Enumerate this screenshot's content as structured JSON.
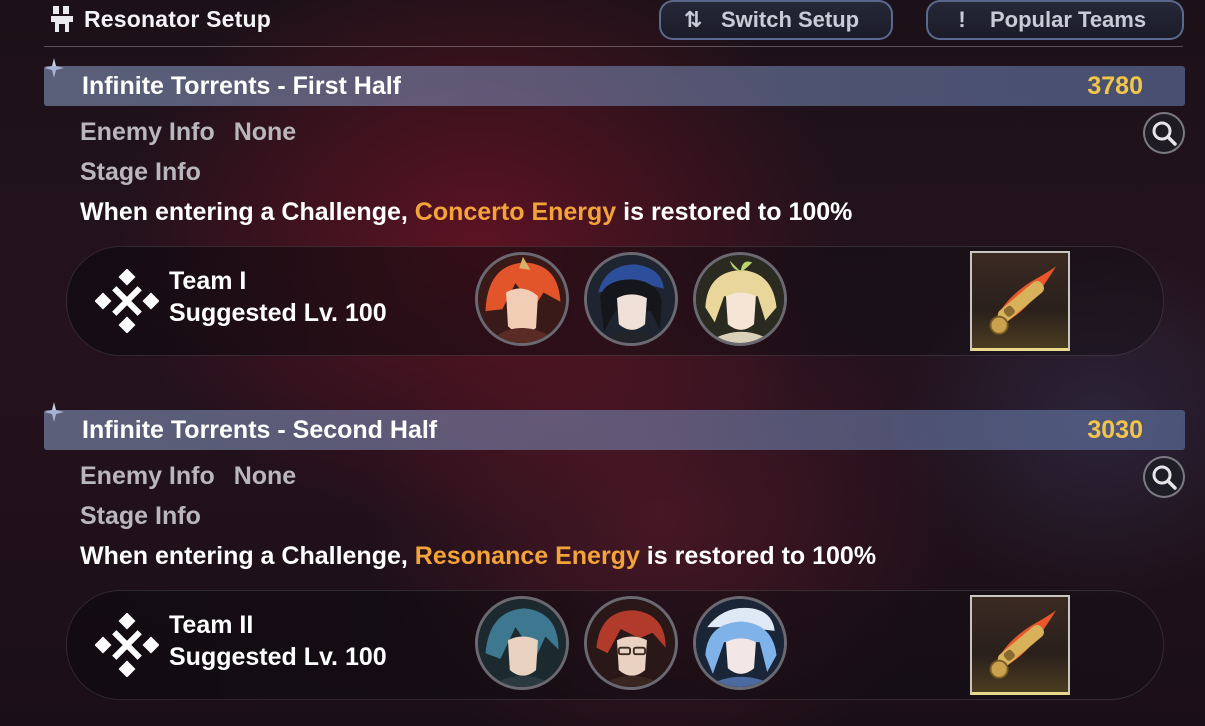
{
  "header": {
    "title": "Resonator Setup",
    "switch_setup_label": "Switch Setup",
    "popular_teams_label": "Popular Teams",
    "switch_icon": "swap-vertical-icon",
    "popular_icon": "exclamation-icon"
  },
  "challenges": [
    {
      "title": "Infinite Torrents - First Half",
      "score": "3780",
      "enemy_label": "Enemy Info",
      "enemy_value": "None",
      "stage_label": "Stage Info",
      "desc_prefix": "When entering a Challenge, ",
      "desc_highlight": "Concerto Energy",
      "desc_suffix": " is restored to 100%",
      "team_name": "Team I",
      "team_level": "Suggested Lv. 100"
    },
    {
      "title": "Infinite Torrents - Second Half",
      "score": "3030",
      "enemy_label": "Enemy Info",
      "enemy_value": "None",
      "stage_label": "Stage Info",
      "desc_prefix": "When entering a Challenge, ",
      "desc_highlight": "Resonance Energy",
      "desc_suffix": " is restored to 100%",
      "team_name": "Team II",
      "team_level": "Suggested Lv. 100"
    }
  ],
  "colors": {
    "score": "#f3c64a",
    "highlight": "#f2a33a",
    "muted_text": "#b9b7bc"
  }
}
